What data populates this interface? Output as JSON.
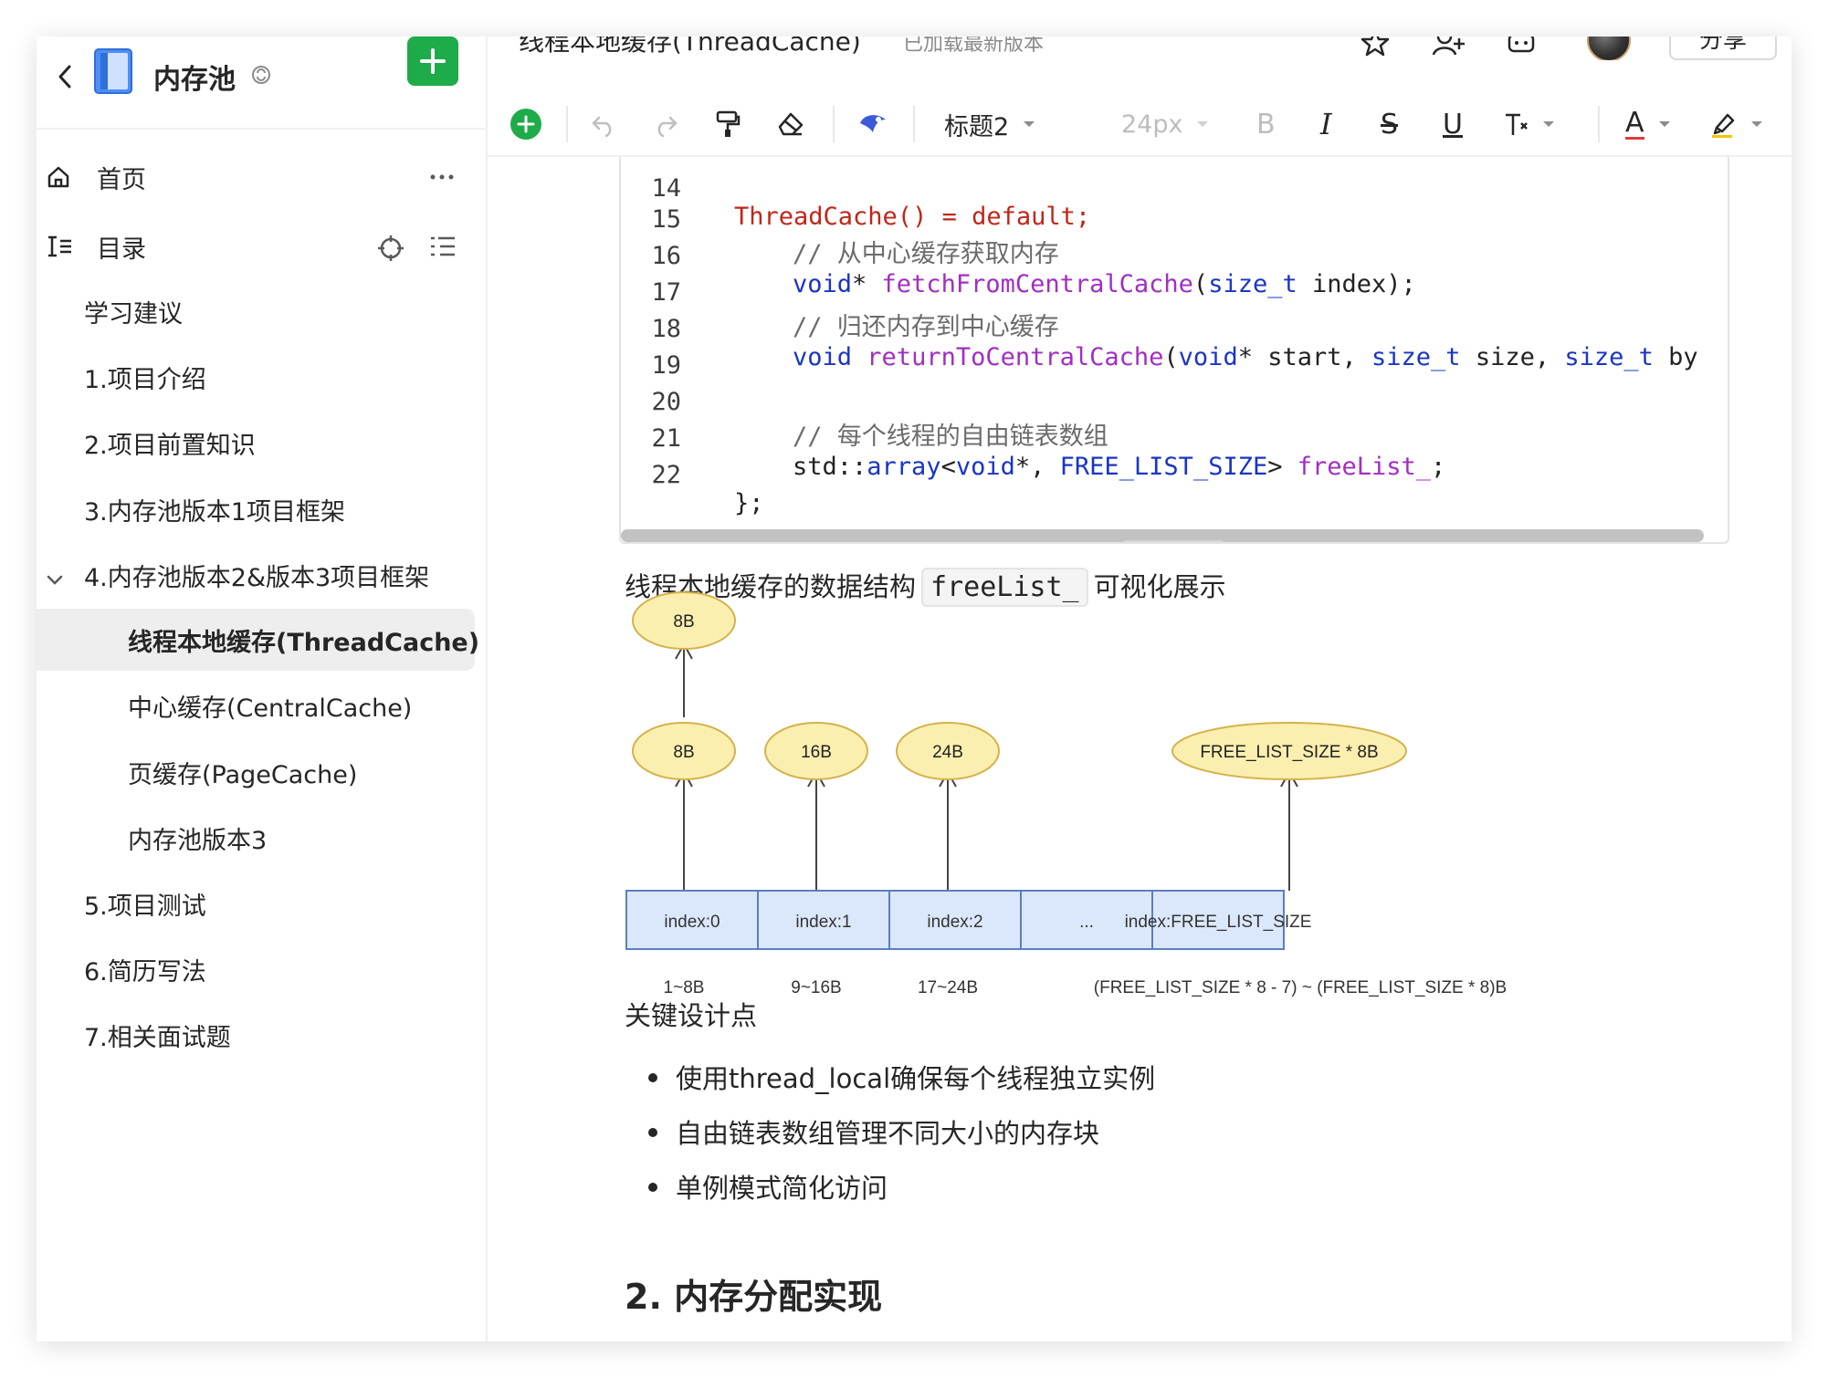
{
  "sidebar": {
    "title": "内存池",
    "nav": [
      {
        "label": "首页"
      },
      {
        "label": "目录"
      }
    ],
    "toc": [
      {
        "label": "学习建议"
      },
      {
        "label": "1.项目介绍"
      },
      {
        "label": "2.项目前置知识"
      },
      {
        "label": "3.内存池版本1项目框架"
      },
      {
        "label": "4.内存池版本2&版本3项目框架"
      },
      {
        "label": "线程本地缓存(ThreadCache)"
      },
      {
        "label": "中心缓存(CentralCache)"
      },
      {
        "label": "页缓存(PageCache)"
      },
      {
        "label": "内存池版本3"
      },
      {
        "label": "5.项目测试"
      },
      {
        "label": "6.简历写法"
      },
      {
        "label": "7.相关面试题"
      }
    ]
  },
  "header": {
    "doc_title": "线程本地缓存(ThreadCache)",
    "status": "已加载最新版本",
    "share_label": "分享"
  },
  "toolbar": {
    "heading": "标题2",
    "font_size": "24px",
    "bold": "B",
    "italic": "I",
    "strike": "S",
    "underline": "U",
    "font_color": "A"
  },
  "code": {
    "lines": [
      {
        "n": "14",
        "text": "ThreadCache() = default;"
      },
      {
        "n": "15",
        "text": "// 从中心缓存获取内存"
      },
      {
        "n": "16",
        "text": "void* fetchFromCentralCache(size_t index);"
      },
      {
        "n": "17",
        "text": "// 归还内存到中心缓存"
      },
      {
        "n": "18",
        "text": "void returnToCentralCache(void* start, size_t size, size_t by"
      },
      {
        "n": "19",
        "text": ""
      },
      {
        "n": "20",
        "text": "// 每个线程的自由链表数组"
      },
      {
        "n": "21",
        "text": "std::array<void*, FREE_LIST_SIZE> freeList_;"
      },
      {
        "n": "22",
        "text": "};"
      }
    ]
  },
  "content": {
    "caption_before": "线程本地缓存的数据结构",
    "caption_code": "freeList_",
    "caption_after": "可视化展示",
    "diagram": {
      "nodes_top": [
        "8B"
      ],
      "nodes": [
        "8B",
        "16B",
        "24B",
        "FREE_LIST_SIZE * 8B"
      ],
      "cells": [
        "index:0",
        "index:1",
        "index:2",
        "...",
        "index:FREE_LIST_SIZE"
      ],
      "ranges": [
        "1~8B",
        "9~16B",
        "17~24B",
        "(FREE_LIST_SIZE * 8 - 7) ~ (FREE_LIST_SIZE * 8)B"
      ],
      "ellipse_fill": "#fbefb0",
      "cell_fill": "#dbe8fb"
    },
    "key_points_title": "关键设计点",
    "key_points": [
      "使用thread_local确保每个线程独立实例",
      "自由链表数组管理不同大小的内存块",
      "单例模式简化访问"
    ],
    "section_heading": "2. 内存分配实现"
  },
  "colors": {
    "accent_green": "#1eab49",
    "active_item_bg": "#eeeeee"
  }
}
